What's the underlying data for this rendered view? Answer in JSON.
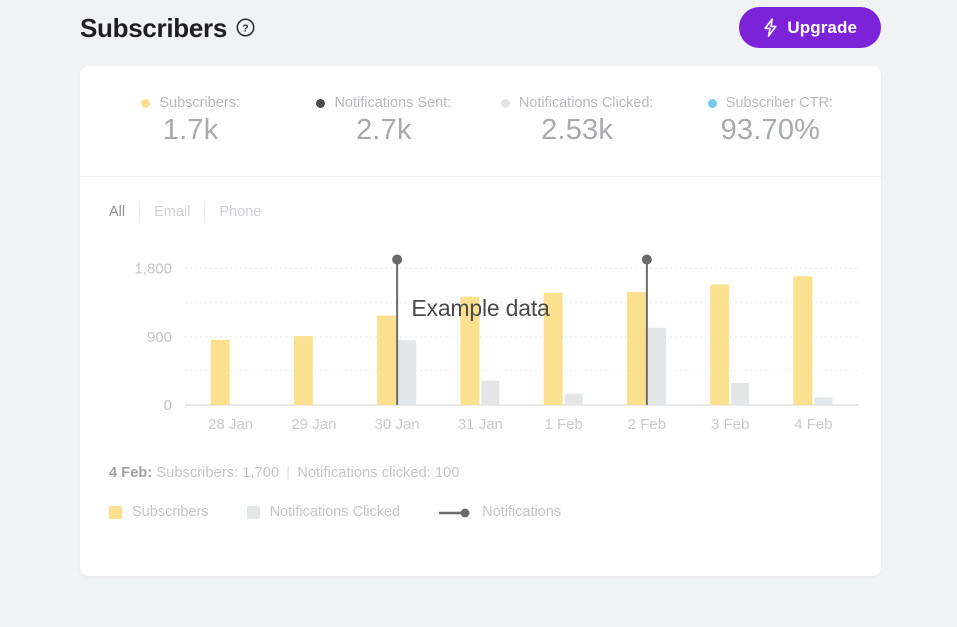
{
  "header": {
    "title": "Subscribers",
    "help_icon": "question-mark-circle-icon",
    "upgrade_label": "Upgrade",
    "upgrade_icon": "lightning-bolt-icon",
    "upgrade_color": "#7c23d9"
  },
  "stats": [
    {
      "label": "Subscribers:",
      "value": "1.7k",
      "dot_color": "#fbe18f"
    },
    {
      "label": "Notifications Sent:",
      "value": "2.7k",
      "dot_color": "#4a4a4a"
    },
    {
      "label": "Notifications Clicked:",
      "value": "2.53k",
      "dot_color": "#e4e5e7"
    },
    {
      "label": "Subscriber CTR:",
      "value": "93.70%",
      "dot_color": "#74c9ec"
    }
  ],
  "tabs": [
    {
      "label": "All",
      "active": true
    },
    {
      "label": "Email",
      "active": false
    },
    {
      "label": "Phone",
      "active": false
    }
  ],
  "watermark": "Example data",
  "caption": {
    "date": "4 Feb:",
    "subscribers": "Subscribers: 1,700",
    "separator": "|",
    "clicked": "Notifications clicked: 100"
  },
  "legend": [
    {
      "label": "Subscribers",
      "color": "#fbe18f",
      "marker": "square"
    },
    {
      "label": "Notifications Clicked",
      "color": "#e4e5e7",
      "marker": "square"
    },
    {
      "label": "Notifications",
      "color": "#6b6b6b",
      "marker": "line-dot"
    }
  ],
  "chart_data": {
    "type": "bar",
    "title": "",
    "xlabel": "",
    "ylabel": "",
    "categories": [
      "28 Jan",
      "29 Jan",
      "30 Jan",
      "31 Jan",
      "1 Feb",
      "2 Feb",
      "3 Feb",
      "4 Feb"
    ],
    "ytick_labels": [
      "0",
      "900",
      "1,800"
    ],
    "yticks": [
      0,
      900,
      1800
    ],
    "ylim": [
      0,
      1980
    ],
    "gridlines": [
      450,
      900,
      1350,
      1800
    ],
    "grid": true,
    "legend_position": "bottom-left",
    "series": [
      {
        "name": "Subscribers",
        "type": "bar",
        "color": "#fbe18f",
        "values": [
          860,
          910,
          1180,
          1430,
          1480,
          1490,
          1590,
          1700
        ]
      },
      {
        "name": "Notifications Clicked",
        "type": "bar",
        "color": "#e4e5e7",
        "values": [
          0,
          0,
          855,
          320,
          150,
          1020,
          290,
          100
        ]
      },
      {
        "name": "Notifications",
        "type": "stem",
        "color": "#6b6b6b",
        "points": [
          {
            "category": "30 Jan",
            "value": 1920
          },
          {
            "category": "2 Feb",
            "value": 1920
          }
        ]
      }
    ]
  }
}
